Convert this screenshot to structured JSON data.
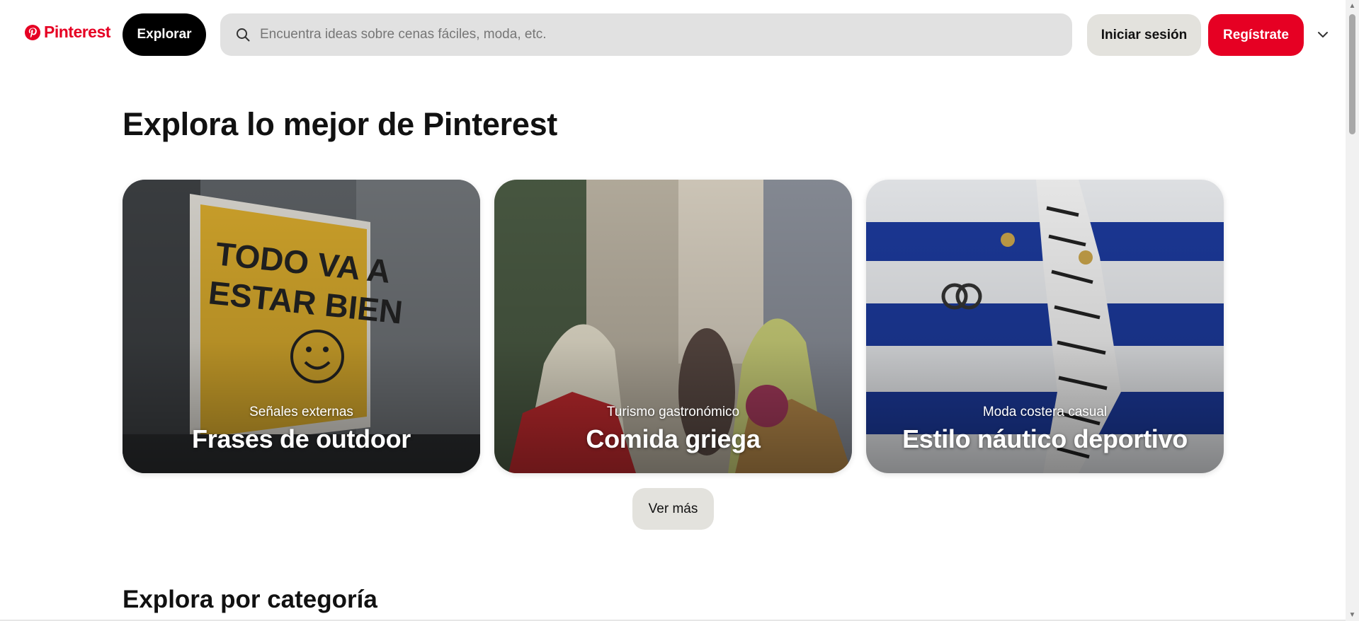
{
  "header": {
    "logo_text": "Pinterest",
    "explore_label": "Explorar",
    "search_placeholder": "Encuentra ideas sobre cenas fáciles, moda, etc.",
    "login_label": "Iniciar sesión",
    "signup_label": "Regístrate",
    "brand_color": "#e60023"
  },
  "main": {
    "title": "Explora lo mejor de Pinterest",
    "cards": [
      {
        "subtitle": "Señales externas",
        "title": "Frases de outdoor"
      },
      {
        "subtitle": "Turismo gastronómico",
        "title": "Comida griega"
      },
      {
        "subtitle": "Moda costera casual",
        "title": "Estilo náutico deportivo"
      }
    ],
    "more_label": "Ver más",
    "section_title": "Explora por categoría"
  },
  "icons": {
    "logo": "pinterest-logo-icon",
    "search": "search-icon",
    "chevron": "chevron-down-icon"
  }
}
